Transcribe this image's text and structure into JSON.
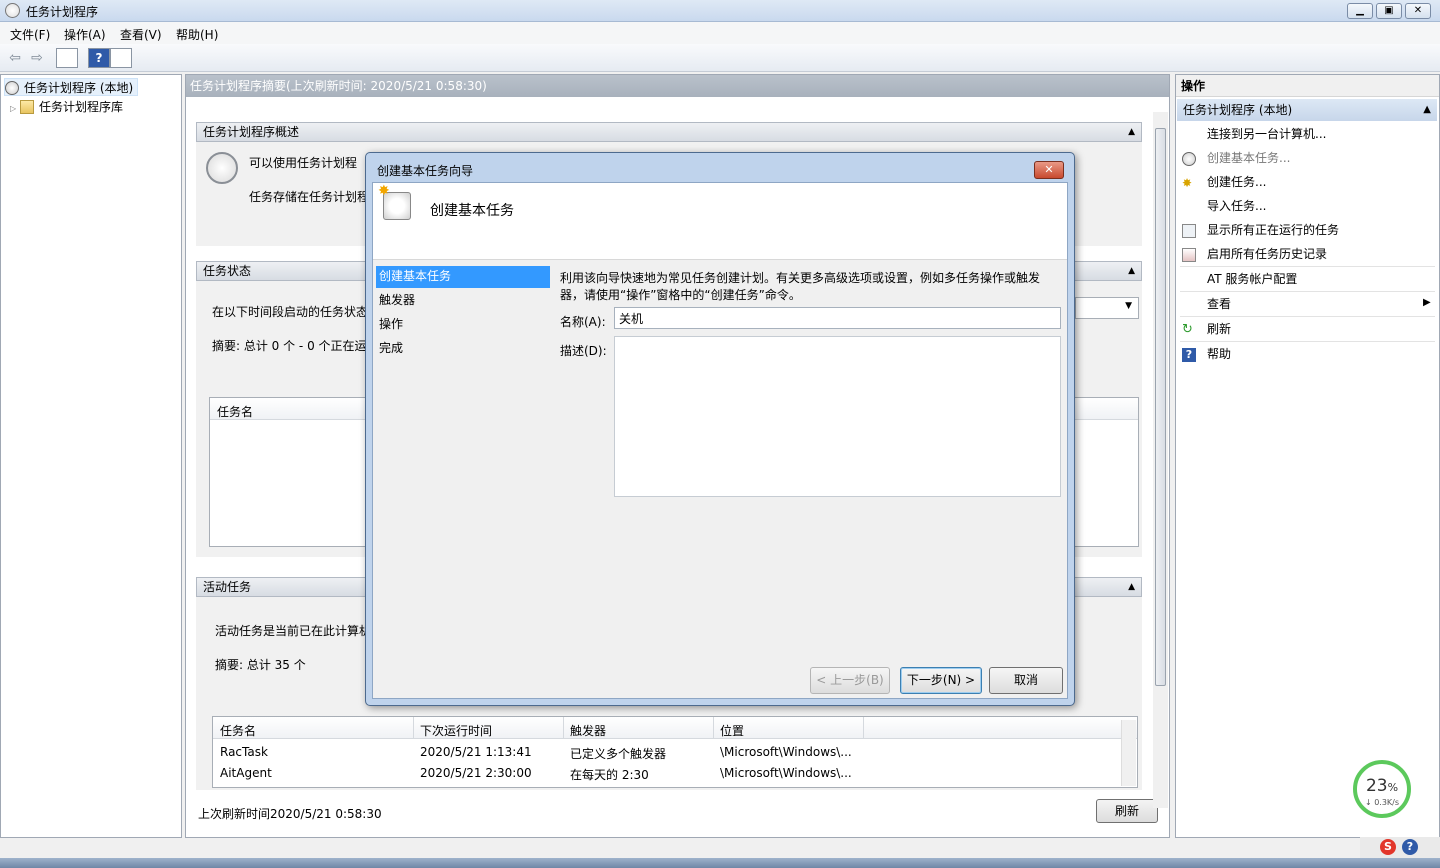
{
  "window": {
    "title": "任务计划程序",
    "btn_min": "▁",
    "btn_max": "▣",
    "btn_close": "✕"
  },
  "menu": [
    "文件(F)",
    "操作(A)",
    "查看(V)",
    "帮助(H)"
  ],
  "tree": {
    "root": "任务计划程序 (本地)",
    "library": "任务计划程序库"
  },
  "center": {
    "header": "任务计划程序摘要(上次刷新时间: 2020/5/21 0:58:30)",
    "overview": {
      "title": "任务计划程序概述",
      "line1": "可以使用任务计划程",
      "line2": "任务存储在任务计划程"
    },
    "status": {
      "title": "任务状态",
      "line1": "在以下时间段启动的任务状态",
      "summary": "摘要: 总计 0 个 - 0 个正在运",
      "col_task": "任务名"
    },
    "active": {
      "title": "活动任务",
      "line1": "活动任务是当前已在此计算机",
      "summary": "摘要: 总计 35 个",
      "columns": [
        "任务名",
        "下次运行时间",
        "触发器",
        "位置"
      ],
      "rows": [
        [
          "RacTask",
          "2020/5/21 1:13:41",
          "已定义多个触发器",
          "\\Microsoft\\Windows\\..."
        ],
        [
          "AitAgent",
          "2020/5/21 2:30:00",
          "在每天的 2:30",
          "\\Microsoft\\Windows\\..."
        ]
      ]
    },
    "footer": "上次刷新时间2020/5/21 0:58:30",
    "refresh_btn": "刷新"
  },
  "actions": {
    "title": "操作",
    "subheader": "任务计划程序 (本地)",
    "items": [
      "连接到另一台计算机...",
      "创建基本任务...",
      "创建任务...",
      "导入任务...",
      "显示所有正在运行的任务",
      "启用所有任务历史记录",
      "AT 服务帐户配置",
      "查看",
      "刷新",
      "帮助"
    ]
  },
  "dialog": {
    "title": "创建基本任务向导",
    "heading": "创建基本任务",
    "steps": [
      "创建基本任务",
      "触发器",
      "操作",
      "完成"
    ],
    "description": "利用该向导快速地为常见任务创建计划。有关更多高级选项或设置，例如多任务操作或触发器，请使用“操作”窗格中的“创建任务”命令。",
    "name_label": "名称(A):",
    "name_value": "关机",
    "desc_label": "描述(D):",
    "btn_back": "< 上一步(B)",
    "btn_next": "下一步(N) >",
    "btn_cancel": "取消"
  },
  "tray": {
    "net_percent": "23",
    "net_unit": "%",
    "net_rate": "↓ 0.3K/s"
  }
}
